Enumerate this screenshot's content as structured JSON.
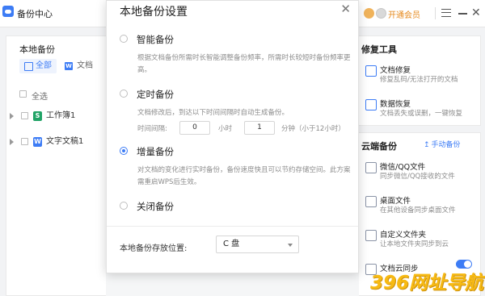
{
  "app": {
    "title": "备份中心"
  },
  "titlebar": {
    "vip_link": "开通会员"
  },
  "left": {
    "section_title": "本地备份",
    "filter_all": "全部",
    "filter_doc": "文档",
    "doc_icon_glyph": "W",
    "select_all": "全选",
    "files": [
      {
        "name": "工作簿1",
        "type": "sheet",
        "glyph": "S"
      },
      {
        "name": "文字文稿1",
        "type": "word",
        "glyph": "W"
      }
    ]
  },
  "right": {
    "repair_title": "修复工具",
    "tools": [
      {
        "title": "文档修复",
        "desc": "修复乱码/无法打开的文档"
      },
      {
        "title": "数据恢复",
        "desc": "文档丢失或误删，一键恢复"
      }
    ],
    "cloud_title": "云端备份",
    "manual_backup": "手动备份",
    "cloud_items": [
      {
        "title": "微信/QQ文件",
        "desc": "同步微信/QQ接收的文件"
      },
      {
        "title": "桌面文件",
        "desc": "在其他设备同步桌面文件"
      },
      {
        "title": "自定义文件夹",
        "desc": "让本地文件夹同步到云"
      },
      {
        "title": "文档云同步",
        "desc": ""
      }
    ],
    "cloud_sync_enabled": true
  },
  "dialog": {
    "title": "本地备份设置",
    "options": [
      {
        "label": "智能备份",
        "desc": "根据文档备份所需时长智能调整备份频率，所需时长较短时备份频率更高。",
        "checked": false
      },
      {
        "label": "定时备份",
        "desc": "文档修改后，到达以下时间间隔时自动生成备份。",
        "checked": false
      },
      {
        "label": "增量备份",
        "desc": "对文档的变化进行实时备份，备份速度快且可以节约存储空间。此方案需重启WPS后生效。",
        "checked": true
      },
      {
        "label": "关闭备份",
        "desc": "",
        "checked": false
      }
    ],
    "interval": {
      "label": "时间间隔:",
      "hours_value": "0",
      "hours_unit": "小时",
      "minutes_value": "1",
      "minutes_unit": "分钟（小于12小时）"
    },
    "location_label": "本地备份存放位置:",
    "location_value": "C 盘"
  },
  "watermark": {
    "text": "396网址导航"
  },
  "colors": {
    "accent": "#3d7cf5",
    "vip": "#e68a1e",
    "watermark": "#f7b500"
  }
}
